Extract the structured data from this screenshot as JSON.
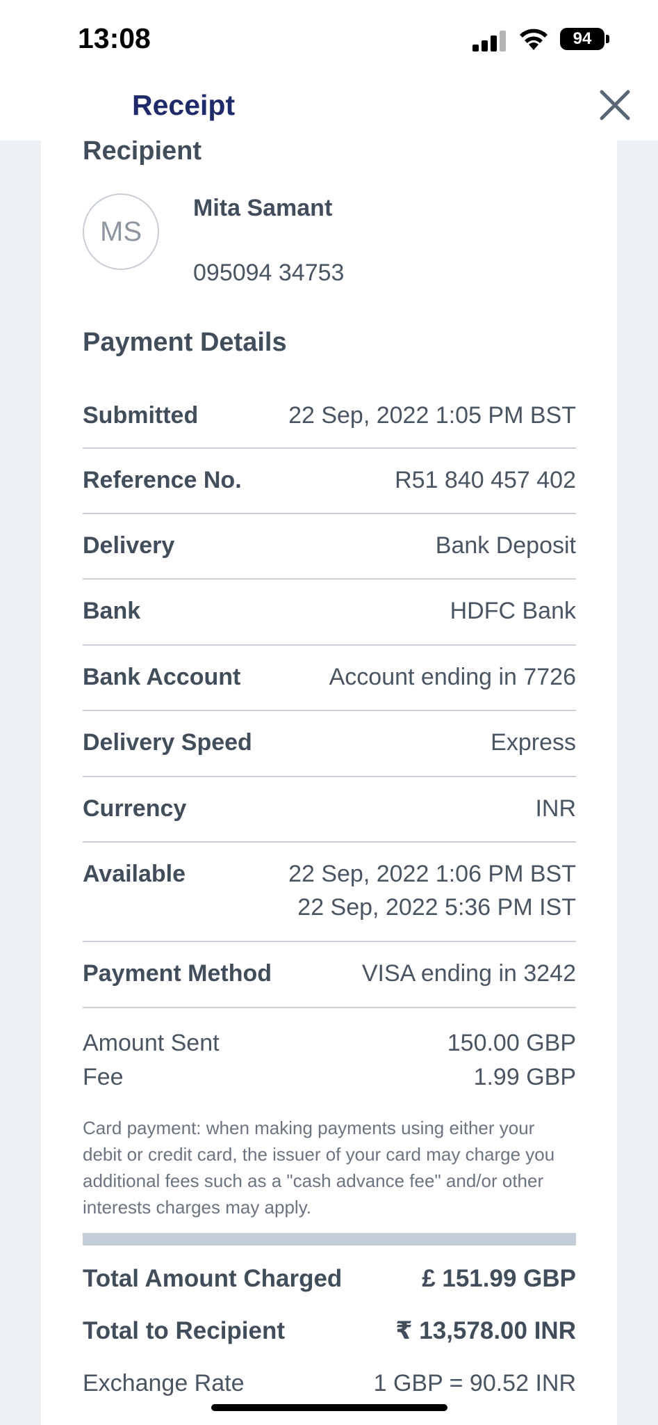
{
  "status_bar": {
    "time": "13:08",
    "battery": "94"
  },
  "header": {
    "title": "Receipt"
  },
  "recipient": {
    "section_title": "Recipient",
    "initials": "MS",
    "name": "Mita Samant",
    "phone": "095094 34753"
  },
  "payment_details": {
    "section_title": "Payment Details",
    "rows": [
      {
        "label": "Submitted",
        "value": "22 Sep, 2022 1:05 PM BST"
      },
      {
        "label": "Reference No.",
        "value": "R51 840 457 402"
      },
      {
        "label": "Delivery",
        "value": "Bank Deposit"
      },
      {
        "label": "Bank",
        "value": "HDFC Bank"
      },
      {
        "label": "Bank Account",
        "value": "Account ending in 7726"
      },
      {
        "label": "Delivery Speed",
        "value": "Express"
      },
      {
        "label": "Currency",
        "value": "INR"
      },
      {
        "label": "Available",
        "value": "22 Sep, 2022 1:06 PM BST",
        "value2": "22 Sep, 2022 5:36 PM IST"
      },
      {
        "label": "Payment Method",
        "value": "VISA ending in 3242"
      }
    ]
  },
  "amounts": {
    "amount_sent_label": "Amount Sent",
    "amount_sent_value": "150.00 GBP",
    "fee_label": "Fee",
    "fee_value": "1.99 GBP",
    "disclaimer": "Card payment: when making payments using either your debit or credit card, the issuer of your card may charge you additional fees such as a \"cash advance fee\" and/or other interests charges may apply."
  },
  "totals": {
    "total_charged_label": "Total Amount Charged",
    "total_charged_value": "£ 151.99 GBP",
    "total_recipient_label": "Total to Recipient",
    "total_recipient_value": "₹ 13,578.00 INR",
    "exchange_rate_label": "Exchange Rate",
    "exchange_rate_value": "1 GBP = 90.52 INR"
  }
}
